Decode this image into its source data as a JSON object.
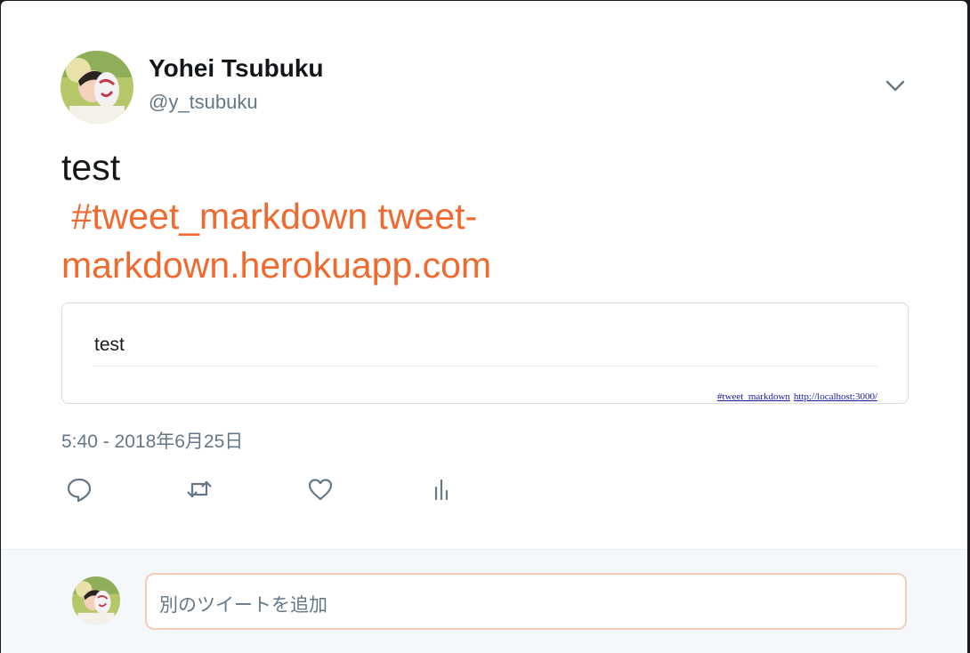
{
  "user": {
    "display_name": "Yohei Tsubuku",
    "screen_name": "@y_tsubuku"
  },
  "tweet": {
    "text_line1": "test",
    "hashtag": "#tweet_markdown",
    "link_part1": "tweet-",
    "link_part2": "markdown.herokuapp.com",
    "timestamp": "5:40 - 2018年6月25日"
  },
  "embed": {
    "title": "test",
    "hashtag_link": "#tweet_markdown",
    "url_link": "http://localhost:3000/"
  },
  "actions": {
    "reply_icon": "reply-icon",
    "retweet_icon": "retweet-icon",
    "like_icon": "heart-icon",
    "analytics_icon": "analytics-icon"
  },
  "reply_box": {
    "placeholder": "別のツイートを追加"
  },
  "colors": {
    "accent": "#f06a2f",
    "secondary_text": "#657786",
    "primary_text": "#14171a"
  }
}
